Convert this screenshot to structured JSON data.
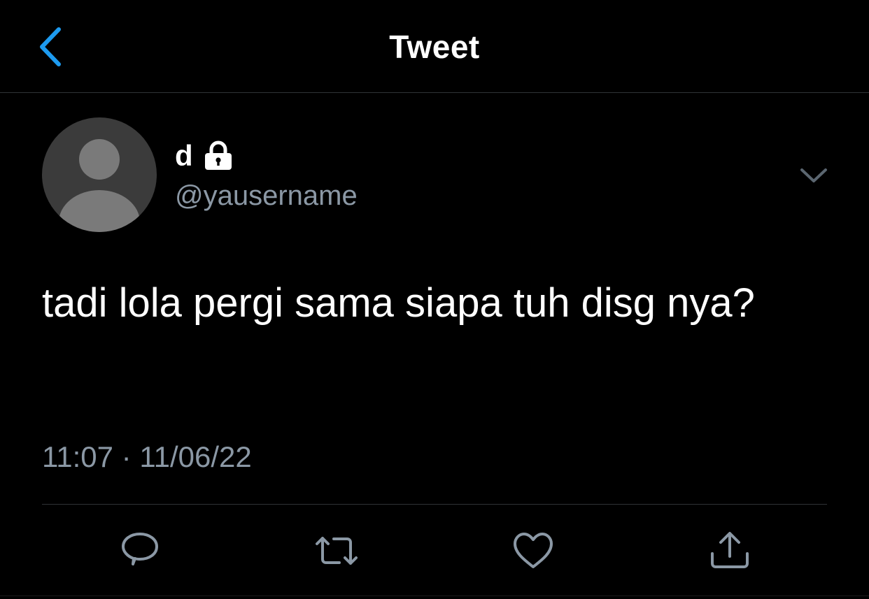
{
  "header": {
    "title": "Tweet",
    "back_icon": "chevron-left-icon",
    "accent_color": "#1d9bf0"
  },
  "tweet": {
    "display_name": "d",
    "protected_icon": "lock-icon",
    "username": "@yausername",
    "text": "tadi lola pergi sama siapa tuh disg nya?",
    "time": "11:07",
    "separator": "·",
    "date": "11/06/22"
  },
  "actions": [
    {
      "icon": "reply-icon"
    },
    {
      "icon": "retweet-icon"
    },
    {
      "icon": "like-icon"
    },
    {
      "icon": "share-icon"
    }
  ],
  "colors": {
    "background": "#000000",
    "text": "#ffffff",
    "secondary_text": "#8b98a5",
    "divider": "#2f3336",
    "avatar_bg": "#3b3b3b",
    "avatar_fg": "#7a7a7a"
  }
}
